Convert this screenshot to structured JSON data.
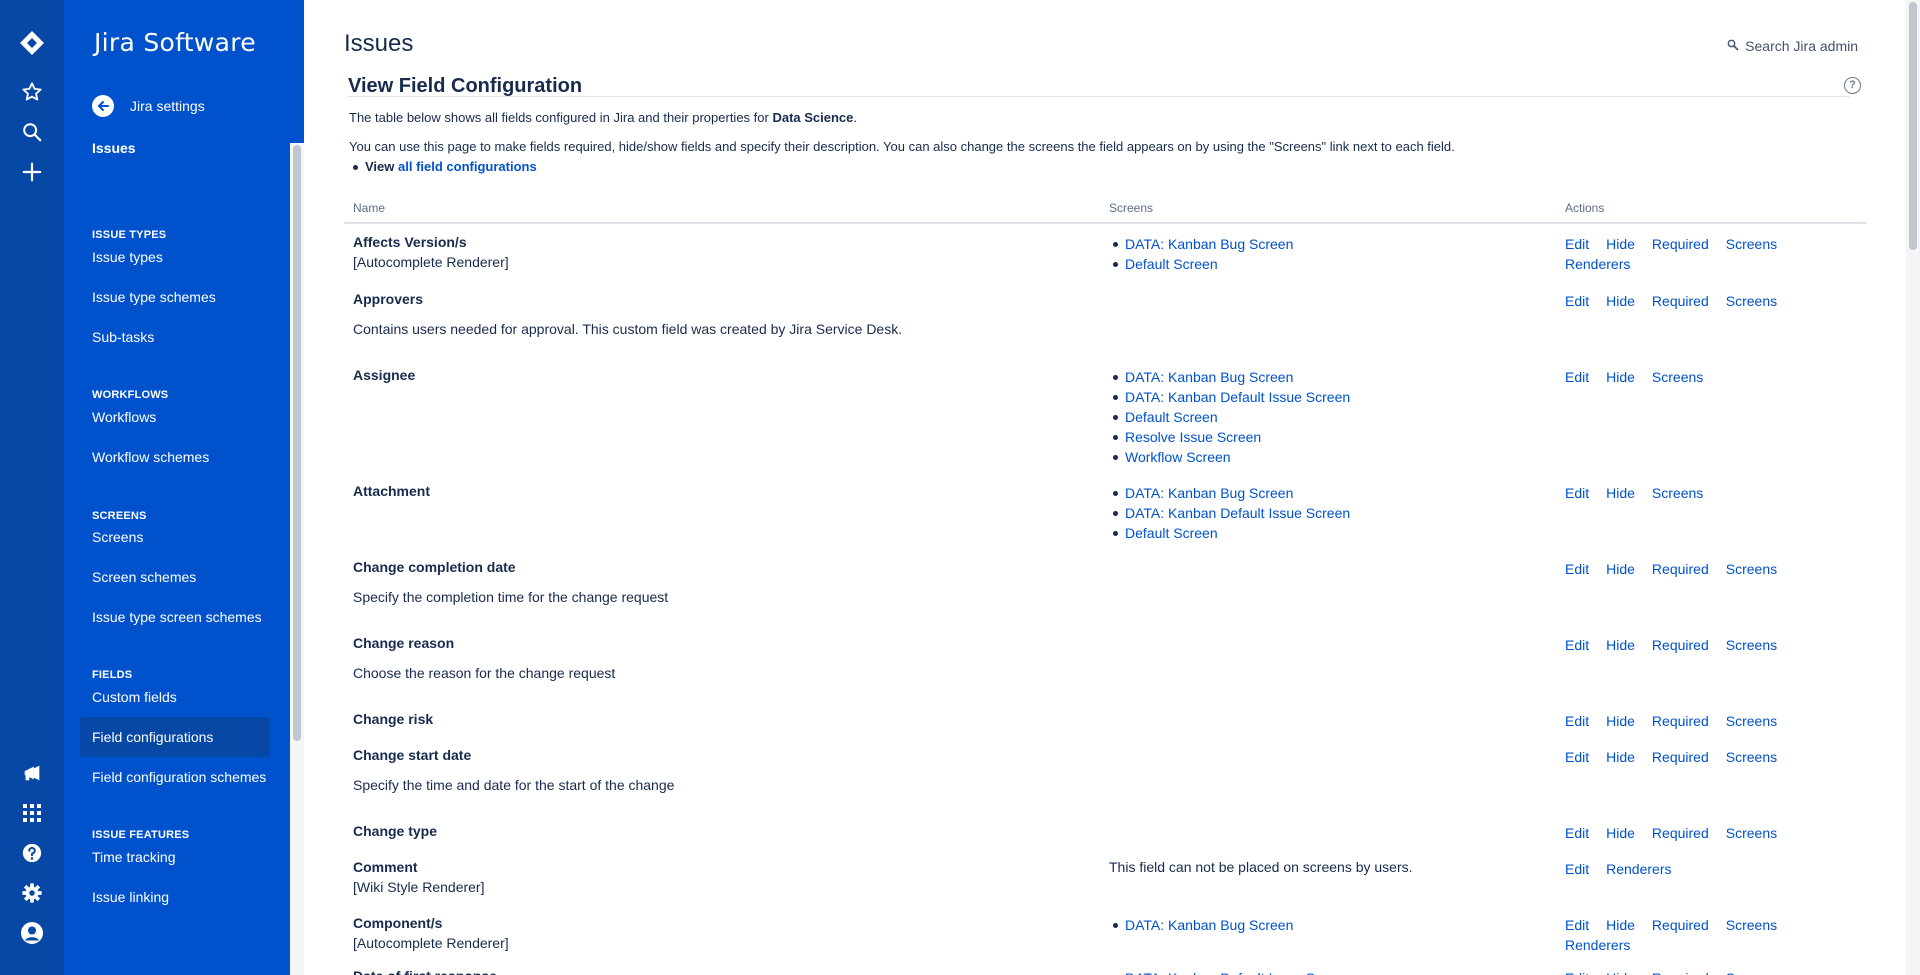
{
  "colors": {
    "rail": "#0747a6",
    "sidebar": "#0052cc",
    "link": "#0052cc",
    "text": "#172b4d"
  },
  "rail": {
    "icons": [
      "jira-logo-icon",
      "star-icon",
      "search-icon",
      "create-icon",
      "megaphone-icon",
      "app-switcher-icon",
      "help-icon",
      "settings-icon",
      "profile-icon"
    ]
  },
  "sidebar": {
    "title": "Jira Software",
    "back_label": "Jira settings",
    "items": [
      {
        "type": "item",
        "label": "Issues",
        "bold": true
      },
      {
        "type": "heading",
        "label": "ISSUE TYPES"
      },
      {
        "type": "item",
        "label": "Issue types"
      },
      {
        "type": "item",
        "label": "Issue type schemes"
      },
      {
        "type": "item",
        "label": "Sub-tasks"
      },
      {
        "type": "heading",
        "label": "WORKFLOWS"
      },
      {
        "type": "item",
        "label": "Workflows"
      },
      {
        "type": "item",
        "label": "Workflow schemes"
      },
      {
        "type": "heading",
        "label": "SCREENS"
      },
      {
        "type": "item",
        "label": "Screens"
      },
      {
        "type": "item",
        "label": "Screen schemes"
      },
      {
        "type": "item",
        "label": "Issue type screen schemes"
      },
      {
        "type": "heading",
        "label": "FIELDS"
      },
      {
        "type": "item",
        "label": "Custom fields"
      },
      {
        "type": "item",
        "label": "Field configurations",
        "active": true
      },
      {
        "type": "item",
        "label": "Field configuration schemes"
      },
      {
        "type": "heading",
        "label": "ISSUE FEATURES"
      },
      {
        "type": "item",
        "label": "Time tracking"
      },
      {
        "type": "item",
        "label": "Issue linking"
      }
    ]
  },
  "header": {
    "title": "Issues",
    "search_label": "Search Jira admin"
  },
  "section": {
    "title": "View Field Configuration",
    "desc1_prefix": "The table below shows all fields configured in Jira and their properties for ",
    "desc1_project": "Data Science",
    "desc1_suffix": ".",
    "desc2": "You can use this page to make fields required, hide/show fields and specify their description. You can also change the screens the field appears on by using the \"Screens\" link next to each field.",
    "view_prefix": "View ",
    "view_link": "all field configurations"
  },
  "table": {
    "headers": {
      "name": "Name",
      "screens": "Screens",
      "actions": "Actions"
    },
    "rows": [
      {
        "name": "Affects Version/s",
        "sub": "[Autocomplete Renderer]",
        "screens": [
          "DATA: Kanban Bug Screen",
          "Default Screen"
        ],
        "actions": [
          "Edit",
          "Hide",
          "Required",
          "Screens",
          "Renderers"
        ]
      },
      {
        "name": "Approvers",
        "desc": "Contains users needed for approval. This custom field was created by Jira Service Desk.",
        "screens": [],
        "actions": [
          "Edit",
          "Hide",
          "Required",
          "Screens"
        ]
      },
      {
        "name": "Assignee",
        "screens": [
          "DATA: Kanban Bug Screen",
          "DATA: Kanban Default Issue Screen",
          "Default Screen",
          "Resolve Issue Screen",
          "Workflow Screen"
        ],
        "actions": [
          "Edit",
          "Hide",
          "Screens"
        ]
      },
      {
        "name": "Attachment",
        "screens": [
          "DATA: Kanban Bug Screen",
          "DATA: Kanban Default Issue Screen",
          "Default Screen"
        ],
        "actions": [
          "Edit",
          "Hide",
          "Screens"
        ]
      },
      {
        "name": "Change completion date",
        "desc": "Specify the completion time for the change request",
        "screens": [],
        "actions": [
          "Edit",
          "Hide",
          "Required",
          "Screens"
        ]
      },
      {
        "name": "Change reason",
        "desc": "Choose the reason for the change request",
        "screens": [],
        "actions": [
          "Edit",
          "Hide",
          "Required",
          "Screens"
        ]
      },
      {
        "name": "Change risk",
        "screens": [],
        "actions": [
          "Edit",
          "Hide",
          "Required",
          "Screens"
        ]
      },
      {
        "name": "Change start date",
        "desc": "Specify the time and date for the start of the change",
        "screens": [],
        "actions": [
          "Edit",
          "Hide",
          "Required",
          "Screens"
        ]
      },
      {
        "name": "Change type",
        "screens": [],
        "actions": [
          "Edit",
          "Hide",
          "Required",
          "Screens"
        ]
      },
      {
        "name": "Comment",
        "sub": "[Wiki Style Renderer]",
        "note": "This field can not be placed on screens by users.",
        "screens": [],
        "actions": [
          "Edit",
          "Renderers"
        ]
      },
      {
        "name": "Component/s",
        "sub": "[Autocomplete Renderer]",
        "screens": [
          "DATA: Kanban Bug Screen"
        ],
        "actions": [
          "Edit",
          "Hide",
          "Required",
          "Screens",
          "Renderers"
        ]
      },
      {
        "name": "Date of first response",
        "screens": [
          "DATA: Kanban Default Issue Screen"
        ],
        "actions": [
          "Edit",
          "Hide",
          "Required",
          "Screens"
        ]
      }
    ]
  }
}
